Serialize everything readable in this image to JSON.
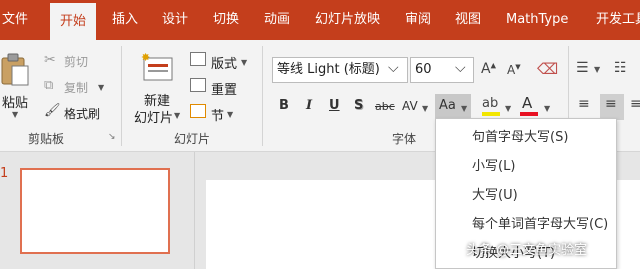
{
  "tabs": {
    "file": "文件",
    "home": "开始",
    "insert": "插入",
    "design": "设计",
    "transitions": "切换",
    "animations": "动画",
    "slideshow": "幻灯片放映",
    "review": "审阅",
    "view": "视图",
    "mathtype": "MathType",
    "developer": "开发工具"
  },
  "clipboard": {
    "paste": "粘贴",
    "cut": "剪切",
    "copy": "复制",
    "format_painter": "格式刷",
    "group_label": "剪贴板"
  },
  "slides": {
    "new_slide_line1": "新建",
    "new_slide_line2": "幻灯片",
    "layout": "版式",
    "reset": "重置",
    "section": "节",
    "group_label": "幻灯片"
  },
  "font": {
    "font_name": "等线 Light (标题)",
    "font_size": "60",
    "bold": "B",
    "italic": "I",
    "underline": "U",
    "shadow": "S",
    "strikethrough": "abc",
    "spacing": "AV",
    "change_case": "Aa",
    "group_label": "字体",
    "highlight_color": "#f2e600",
    "font_color": "#e81123"
  },
  "workspace": {
    "slide_number": "1"
  },
  "case_menu": {
    "items": [
      "句首字母大写(S)",
      "小写(L)",
      "大写(U)",
      "每个单词首字母大写(C)",
      "切换大小写(T)"
    ]
  },
  "watermark": "头条 @三文鱼实验室"
}
